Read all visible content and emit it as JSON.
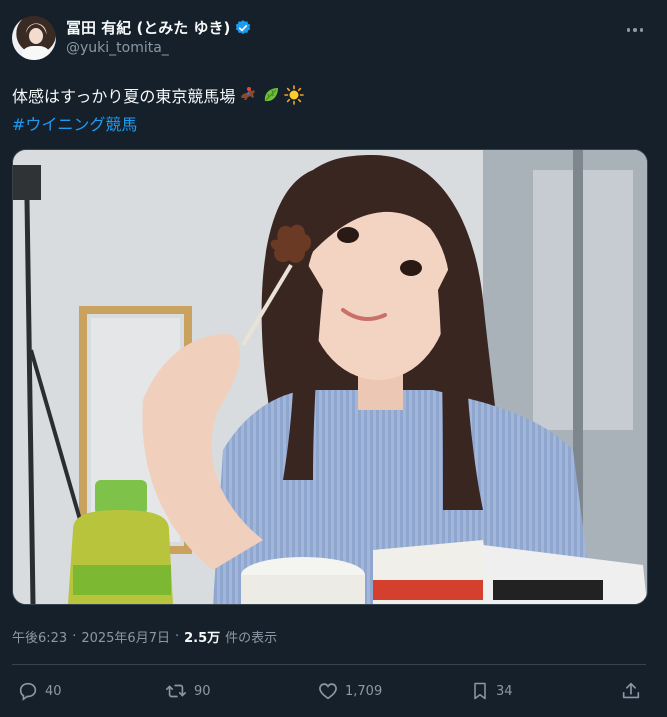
{
  "author": {
    "display_name": "冨田 有紀 (とみた ゆき)",
    "handle": "@yuki_tomita_",
    "verified": true
  },
  "tweet": {
    "text": "体感はすっかり夏の東京競馬場",
    "emojis": [
      "horse-racing-icon",
      "leaf-icon",
      "sun-icon"
    ],
    "hashtag": "#ウイニング競馬"
  },
  "meta": {
    "time": "午後6:23",
    "separator": "·",
    "date": "2025年6月7日",
    "views": "2.5万",
    "views_label": "件の表示"
  },
  "actions": {
    "replies": "40",
    "retweets": "90",
    "likes": "1,709",
    "bookmarks": "34"
  },
  "colors": {
    "background": "#15202b",
    "accent": "#1d9bf0",
    "muted": "#8b98a5",
    "border": "#38444d"
  }
}
